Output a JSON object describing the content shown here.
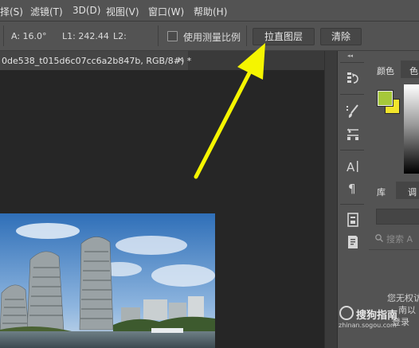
{
  "menubar": {
    "items": [
      "择(S)",
      "滤镜(T)",
      "3D(D)",
      "视图(V)",
      "窗口(W)",
      "帮助(H)"
    ]
  },
  "options": {
    "angle": "A: 16.0°",
    "l1": "L1: 242.44",
    "l2": "L2:",
    "use_scale_label": "使用测量比例",
    "straighten_label": "拉直图层",
    "clear_label": "清除"
  },
  "document": {
    "tab_title": "0de538_t015d6c07cc6a2b847b, RGB/8#) *",
    "close_glyph": "×"
  },
  "panels": {
    "collapse_glyph": "◂◂",
    "color_tab": "颜色",
    "swatches_tab": "色",
    "libraries_tab": "库",
    "adjust_tab": "调",
    "search_placeholder": "搜索 A",
    "note_line1": "您无权访",
    "note_line2": "南以",
    "note_line3": "登录"
  },
  "watermark": {
    "text": "搜狗指南",
    "url": "zhinan.sogou.com"
  },
  "colors": {
    "foreground": "#a6c83a",
    "background": "#f2e52b",
    "arrow": "#f5f500"
  }
}
